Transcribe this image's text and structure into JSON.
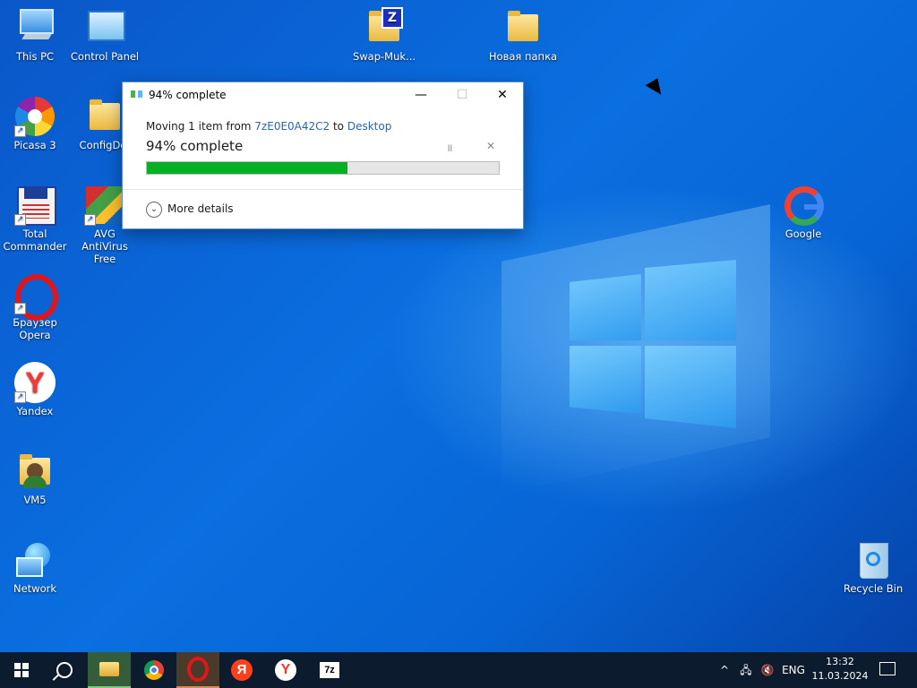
{
  "desktop": {
    "icons": [
      {
        "label": "This PC"
      },
      {
        "label": "Control Panel"
      },
      {
        "label": "Swap-Muk..."
      },
      {
        "label": "Новая папка"
      },
      {
        "label": "Picasa 3"
      },
      {
        "label": "ConfigDef"
      },
      {
        "label": "Total Commander"
      },
      {
        "label": "AVG AntiVirus Free"
      },
      {
        "label": "Браузер Opera"
      },
      {
        "label": "Yandex"
      },
      {
        "label": "VM5"
      },
      {
        "label": "Network"
      },
      {
        "label": "Google"
      },
      {
        "label": "Recycle Bin"
      }
    ]
  },
  "dialog": {
    "title": "94% complete",
    "moving_prefix": "Moving 1 item from ",
    "source": "7zE0E0A42C2",
    "to_word": " to ",
    "destination": "Desktop",
    "status": "94% complete",
    "progress_percent": 57,
    "more_details": "More details",
    "minimize_symbol": "—",
    "maximize_symbol": "☐",
    "close_symbol": "✕",
    "pause_symbol": "॥",
    "stop_symbol": "✕",
    "progress_color": "#06b025"
  },
  "taskbar": {
    "apps": [
      "start-icon",
      "search-icon",
      "file-explorer-icon",
      "chrome-icon",
      "opera-icon",
      "yandex-browser-icon",
      "yandex-icon",
      "7zip-icon"
    ],
    "seven_zip_label": "7z",
    "yandex_browser_letter": "Я",
    "yandex_letter": "Y",
    "tray": {
      "chevron": "^",
      "language": "ENG",
      "time": "13:32",
      "date": "11.03.2024"
    }
  }
}
